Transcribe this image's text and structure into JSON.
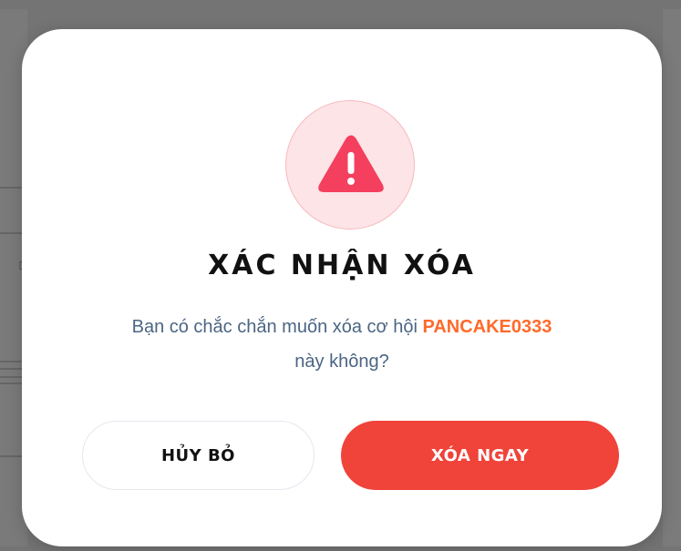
{
  "dialog": {
    "icon": "warning-triangle-icon",
    "title": "XÁC NHẬN XÓA",
    "message_before": "Bạn có chắc chắn muốn xóa cơ hội ",
    "message_highlight": "PANCAKE0333",
    "message_after": " này không?",
    "cancel_label": "HỦY BỎ",
    "confirm_label": "XÓA NGAY"
  },
  "colors": {
    "accent_danger": "#f0433a",
    "highlight": "#ff6a2b",
    "icon_bg": "#fde4e6",
    "icon_fill": "#f43f5e",
    "message_text": "#4b6584"
  }
}
